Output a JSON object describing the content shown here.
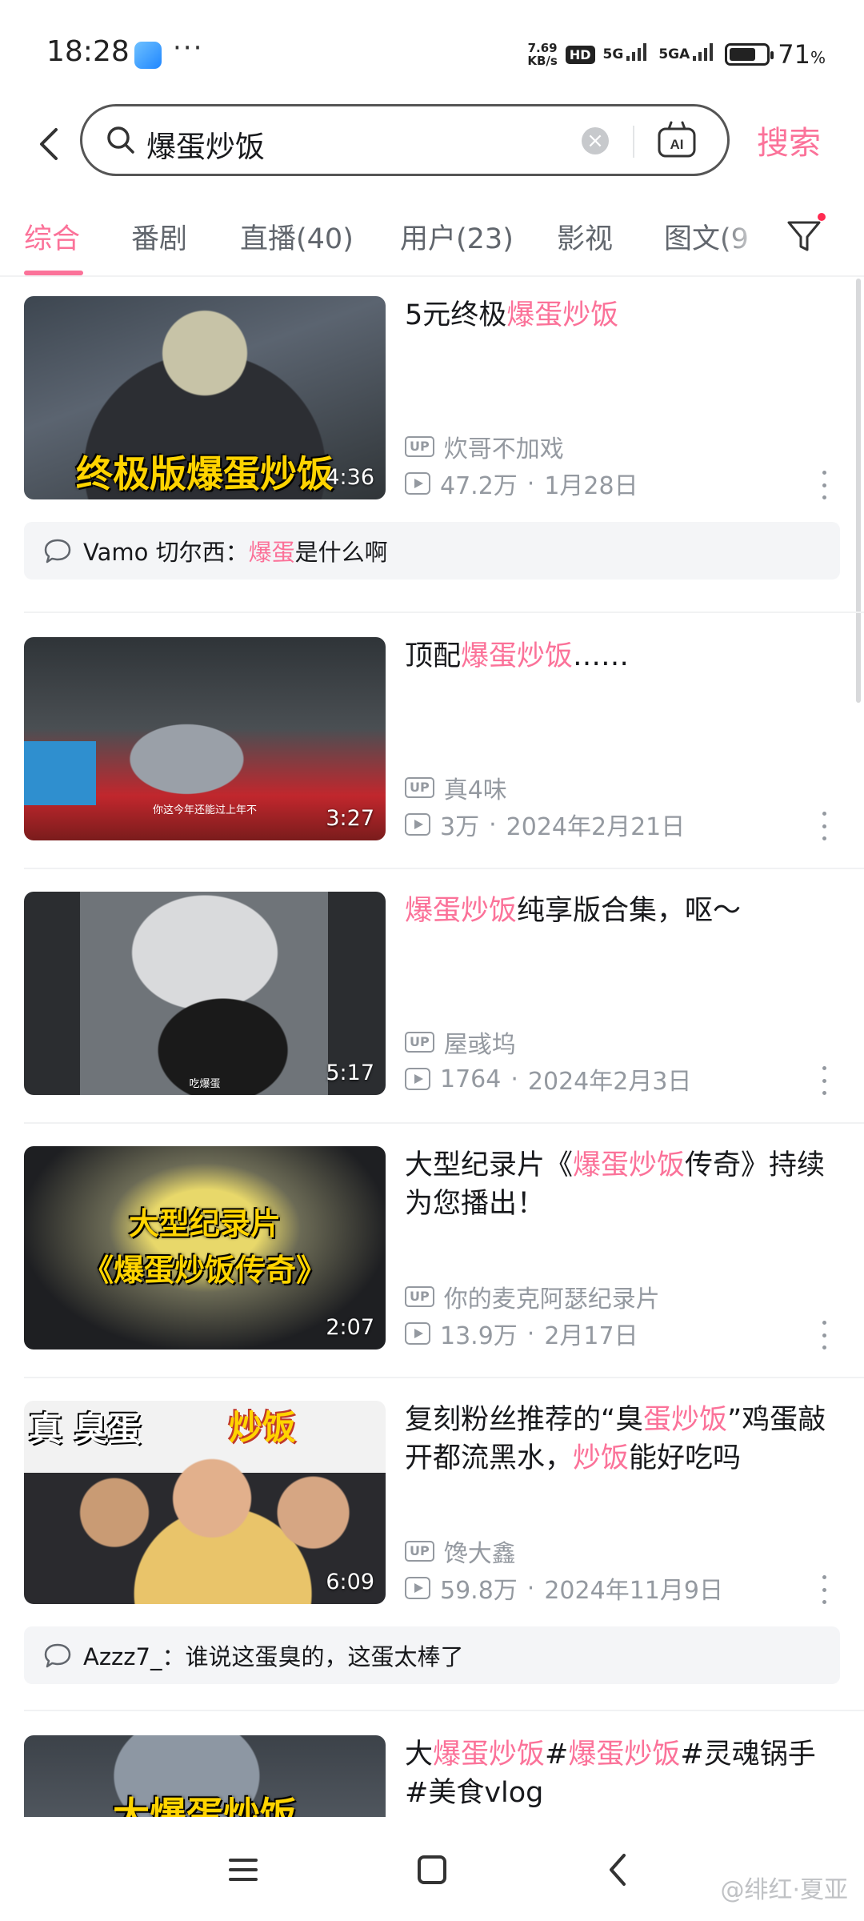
{
  "status_bar": {
    "time": "18:28",
    "more_dots": "···",
    "net_speed_value": "7.69",
    "net_speed_unit": "KB/s",
    "hd": "HD",
    "net1": "5G",
    "net2": "5GA",
    "battery_percent": 71,
    "battery_text": "71",
    "battery_unit": "%"
  },
  "search": {
    "query": "爆蛋炒饭",
    "clear_glyph": "×",
    "submit_label": "搜索",
    "ai_label": "AI"
  },
  "tabs": [
    "综合",
    "番剧",
    "直播(40)",
    "用户(23)",
    "影视",
    "图文(9"
  ],
  "results": [
    {
      "title_parts": [
        {
          "t": "5元终极",
          "hl": false
        },
        {
          "t": "爆蛋炒饭",
          "hl": true
        }
      ],
      "uploader": "炊哥不加戏",
      "views": "47.2万",
      "dot": "·",
      "date": "1月28日",
      "duration": "4:36",
      "thumb_caption": "终极版爆蛋炒饭",
      "comment": {
        "user": "Vamo 切尔西：",
        "hl": "爆蛋",
        "rest": "是什么啊"
      }
    },
    {
      "title_parts": [
        {
          "t": "顶配",
          "hl": false
        },
        {
          "t": "爆蛋炒饭",
          "hl": true
        },
        {
          "t": "……",
          "hl": false
        }
      ],
      "uploader": "真4味",
      "views": "3万",
      "dot": "·",
      "date": "2024年2月21日",
      "duration": "3:27",
      "thumb_caption": "你这今年还能过上年不"
    },
    {
      "title_parts": [
        {
          "t": "爆蛋炒饭",
          "hl": true
        },
        {
          "t": "纯享版合集，呕～",
          "hl": false
        }
      ],
      "uploader": "屋彧坞",
      "views": "1764",
      "dot": "·",
      "date": "2024年2月3日",
      "duration": "5:17",
      "thumb_caption": "吃爆蛋"
    },
    {
      "title_parts": [
        {
          "t": "大型纪录片《",
          "hl": false
        },
        {
          "t": "爆蛋炒饭",
          "hl": true
        },
        {
          "t": "传奇》持续为您播出！",
          "hl": false
        }
      ],
      "uploader": "你的麦克阿瑟纪录片",
      "views": "13.9万",
      "dot": "·",
      "date": "2月17日",
      "duration": "2:07",
      "thumb_caption_line1": "大型纪录片",
      "thumb_caption_line2": "《爆蛋炒饭传奇》"
    },
    {
      "title_parts": [
        {
          "t": "复刻粉丝推荐的“臭",
          "hl": false
        },
        {
          "t": "蛋炒饭",
          "hl": true
        },
        {
          "t": "”鸡蛋敲开都流黑水，",
          "hl": false
        },
        {
          "t": "炒饭",
          "hl": true
        },
        {
          "t": "能好吃吗",
          "hl": false
        }
      ],
      "uploader": "馋大鑫",
      "views": "59.8万",
      "dot": "·",
      "date": "2024年11月9日",
      "duration": "6:09",
      "thumb_caption_a": "真 臭蛋",
      "thumb_caption_b": "炒饭",
      "comment": {
        "user": "Azzz7_：",
        "hl": "",
        "rest": "谁说这蛋臭的，这蛋太棒了"
      }
    },
    {
      "title_parts": [
        {
          "t": "大",
          "hl": false
        },
        {
          "t": "爆蛋炒饭",
          "hl": true
        },
        {
          "t": "#",
          "hl": false
        },
        {
          "t": "爆蛋炒饭",
          "hl": true
        },
        {
          "t": "#灵魂锅手#美食vlog",
          "hl": false
        }
      ],
      "thumb_caption": "大爆蛋炒饭"
    }
  ],
  "up_badge": "UP",
  "watermark": "@绯红·夏亚",
  "colors": {
    "accent": "#fb7299",
    "text": "#18191c",
    "muted": "#9499a0"
  }
}
